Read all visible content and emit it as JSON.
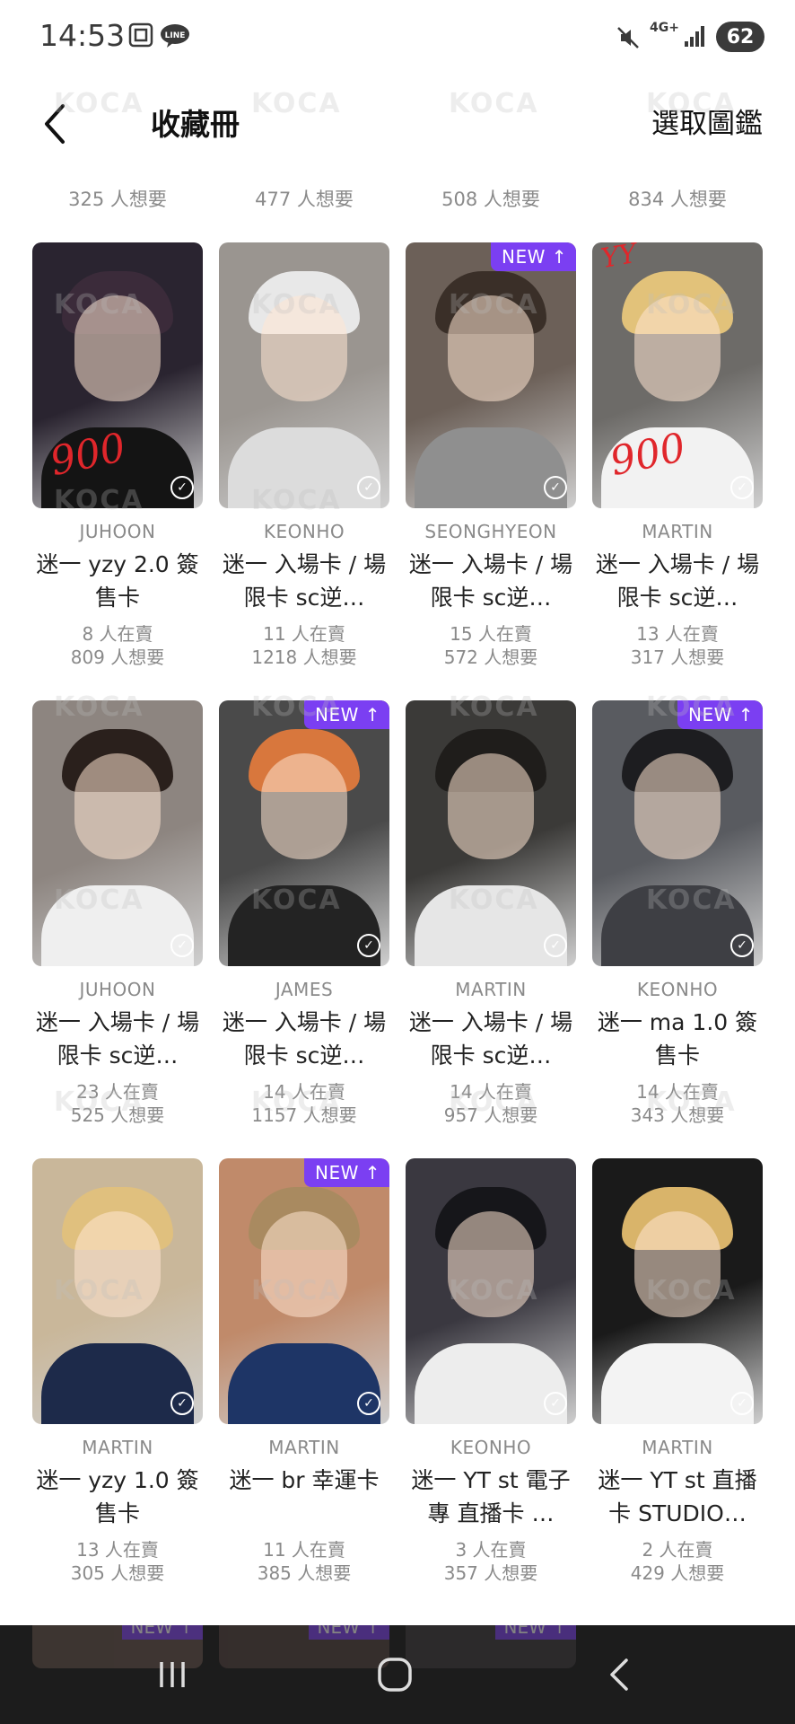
{
  "status_bar": {
    "time": "14:53",
    "network": "4G+",
    "battery": "62"
  },
  "header": {
    "title": "收藏冊",
    "select_label": "選取圖鑑"
  },
  "top_row_partial": [
    {
      "want": "325 人想要"
    },
    {
      "want": "477 人想要"
    },
    {
      "want": "508 人想要"
    },
    {
      "want": "834 人想要"
    }
  ],
  "badge_new": "NEW ↑",
  "watermark": "KOCA",
  "cards": [
    {
      "member": "JUHOON",
      "name": "迷一 yzy 2.0 簽售卡",
      "selling": "8 人在賣",
      "want": "809 人想要",
      "new": false,
      "handwriting": "900",
      "colors": [
        "#2a2430",
        "#3b2b3a",
        "#141414"
      ]
    },
    {
      "member": "KEONHO",
      "name": "迷一 入場卡 / 場限卡 sc逆…",
      "selling": "11 人在賣",
      "want": "1218 人想要",
      "new": false,
      "colors": [
        "#9a9590",
        "#e8e8e8",
        "#dcdcdc"
      ]
    },
    {
      "member": "SEONGHYEON",
      "name": "迷一 入場卡 / 場限卡 sc逆…",
      "selling": "15 人在賣",
      "want": "572 人想要",
      "new": true,
      "colors": [
        "#6c6058",
        "#3a2f28",
        "#8f8f8f"
      ]
    },
    {
      "member": "MARTIN",
      "name": "迷一 入場卡 / 場限卡 sc逆…",
      "selling": "13 人在賣",
      "want": "317 人想要",
      "new": false,
      "handwriting": "900",
      "handwriting_top": "YY",
      "colors": [
        "#6d6b68",
        "#e2c27a",
        "#f2f2f2"
      ]
    },
    {
      "member": "JUHOON",
      "name": "迷一 入場卡 / 場限卡 sc逆…",
      "selling": "23 人在賣",
      "want": "525 人想要",
      "new": false,
      "colors": [
        "#8d8580",
        "#2a201c",
        "#efefef"
      ]
    },
    {
      "member": "JAMES",
      "name": "迷一 入場卡 / 場限卡 sc逆…",
      "selling": "14 人在賣",
      "want": "1157 人想要",
      "new": true,
      "colors": [
        "#4a4a4a",
        "#d8773d",
        "#232323"
      ]
    },
    {
      "member": "MARTIN",
      "name": "迷一 入場卡 / 場限卡 sc逆…",
      "selling": "14 人在賣",
      "want": "957 人想要",
      "new": false,
      "colors": [
        "#3b3a38",
        "#1f1d1b",
        "#e6e6e6"
      ]
    },
    {
      "member": "KEONHO",
      "name": "迷一 ma 1.0 簽售卡",
      "selling": "14 人在賣",
      "want": "343 人想要",
      "new": true,
      "colors": [
        "#595b60",
        "#1d1d20",
        "#3e3f44"
      ]
    },
    {
      "member": "MARTIN",
      "name": "迷一 yzy 1.0 簽售卡",
      "selling": "13 人在賣",
      "want": "305 人想要",
      "new": false,
      "colors": [
        "#c9b79a",
        "#e0c07e",
        "#1d2a4a"
      ]
    },
    {
      "member": "MARTIN",
      "name": "迷一 br 幸運卡",
      "selling": "11 人在賣",
      "want": "385 人想要",
      "new": true,
      "colors": [
        "#c08a6a",
        "#a98a60",
        "#1e3566"
      ]
    },
    {
      "member": "KEONHO",
      "name": "迷一 YT st 電子專 直播卡 …",
      "selling": "3 人在賣",
      "want": "357 人想要",
      "new": false,
      "colors": [
        "#3a3840",
        "#16161a",
        "#ededed"
      ]
    },
    {
      "member": "MARTIN",
      "name": "迷一 YT st 直播卡 STUDIO…",
      "selling": "2 人在賣",
      "want": "429 人想要",
      "new": false,
      "colors": [
        "#1a1a1a",
        "#d9b46a",
        "#f3f3f3"
      ]
    }
  ],
  "nav": {
    "recents_icon": "recents-icon",
    "home_icon": "home-icon",
    "back_icon": "back-icon"
  }
}
